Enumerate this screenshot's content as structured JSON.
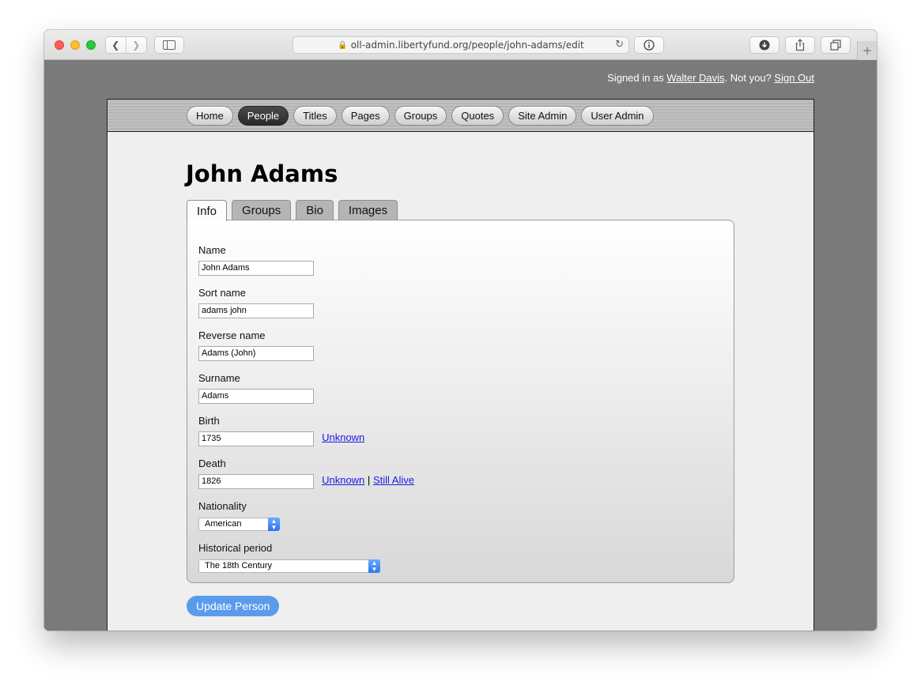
{
  "browser": {
    "url": "oll-admin.libertyfund.org/people/john-adams/edit"
  },
  "signin": {
    "prefix": "Signed in as ",
    "user": "Walter Davis",
    "middle": ". Not you? ",
    "signout": "Sign Out"
  },
  "nav": {
    "items": [
      "Home",
      "People",
      "Titles",
      "Pages",
      "Groups",
      "Quotes",
      "Site Admin",
      "User Admin"
    ],
    "active": "People"
  },
  "page": {
    "title": "John Adams"
  },
  "tabs": [
    "Info",
    "Groups",
    "Bio",
    "Images"
  ],
  "form": {
    "name": {
      "label": "Name",
      "value": "John Adams"
    },
    "sort_name": {
      "label": "Sort name",
      "value": "adams john"
    },
    "reverse_name": {
      "label": "Reverse name",
      "value": "Adams (John)"
    },
    "surname": {
      "label": "Surname",
      "value": "Adams"
    },
    "birth": {
      "label": "Birth",
      "value": "1735",
      "unknown": "Unknown"
    },
    "death": {
      "label": "Death",
      "value": "1826",
      "unknown": "Unknown",
      "separator": "|",
      "alive": "Still Alive"
    },
    "nationality": {
      "label": "Nationality",
      "value": "American"
    },
    "period": {
      "label": "Historical period",
      "value": "The 18th Century"
    }
  },
  "submit_label": "Update Person",
  "colors": {
    "accent": "#5a9ceb",
    "link": "#1a1ae6",
    "page_bg": "#7a7a7a"
  }
}
